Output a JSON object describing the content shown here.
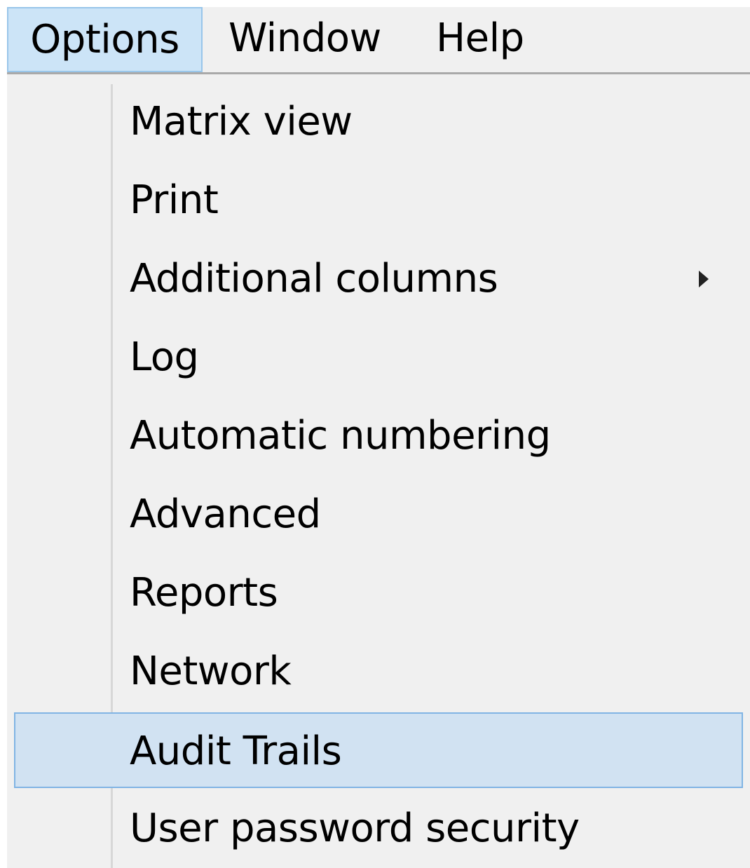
{
  "menubar": {
    "items": [
      {
        "label": "Options",
        "active": true
      },
      {
        "label": "Window",
        "active": false
      },
      {
        "label": "Help",
        "active": false
      }
    ]
  },
  "dropdown": {
    "items": [
      {
        "label": "Matrix view",
        "has_submenu": false,
        "highlighted": false
      },
      {
        "label": "Print",
        "has_submenu": false,
        "highlighted": false
      },
      {
        "label": "Additional columns",
        "has_submenu": true,
        "highlighted": false
      },
      {
        "label": "Log",
        "has_submenu": false,
        "highlighted": false
      },
      {
        "label": "Automatic numbering",
        "has_submenu": false,
        "highlighted": false
      },
      {
        "label": "Advanced",
        "has_submenu": false,
        "highlighted": false
      },
      {
        "label": "Reports",
        "has_submenu": false,
        "highlighted": false
      },
      {
        "label": "Network",
        "has_submenu": false,
        "highlighted": false
      },
      {
        "label": "Audit Trails",
        "has_submenu": false,
        "highlighted": true
      },
      {
        "label": "User password security",
        "has_submenu": false,
        "highlighted": false
      }
    ]
  },
  "colors": {
    "menu_background": "#f0f0f0",
    "active_menu_fill": "#cce4f7",
    "highlight_fill": "#d1e2f2",
    "highlight_border": "#80b4e4",
    "text": "#000000"
  },
  "icons": {
    "submenu": "chevron-right-icon"
  }
}
